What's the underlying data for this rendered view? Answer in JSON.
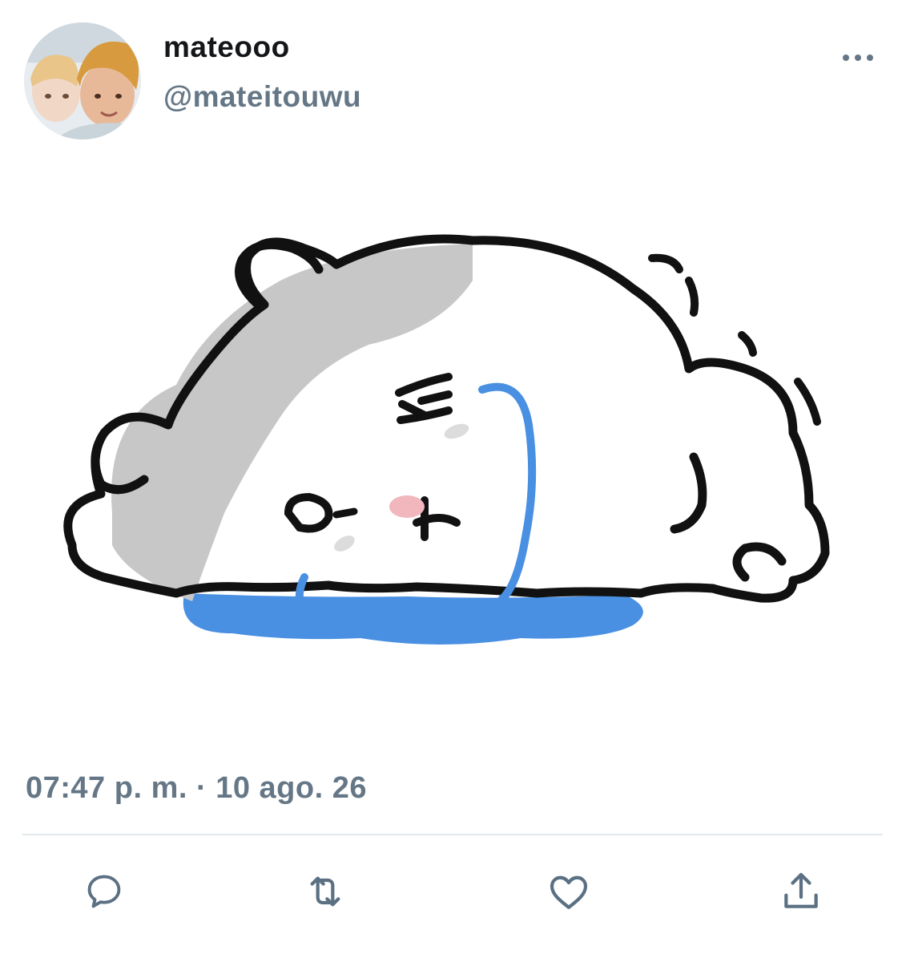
{
  "user": {
    "display_name": "mateooo",
    "handle": "@mateitouwu",
    "avatar": "avatar-photo"
  },
  "tweet": {
    "media": "crying-hamster-sticker",
    "timestamp": "07:47 p. m. · 10 ago. 26"
  },
  "icons": {
    "more": "more-horizontal-icon",
    "reply": "reply-icon",
    "retweet": "retweet-icon",
    "like": "heart-icon",
    "share": "share-icon"
  },
  "colors": {
    "name": "#14171a",
    "secondary": "#657786",
    "icon": "#5b7083",
    "divider": "#e1e8ed",
    "tear": "#4a90e2"
  }
}
